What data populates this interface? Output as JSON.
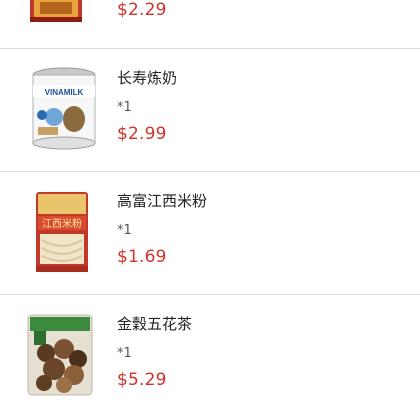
{
  "items": [
    {
      "name": "",
      "qty": "",
      "price": "$2.29",
      "icon": "sauce-packet-icon"
    },
    {
      "name": "长寿炼奶",
      "qty": "*1",
      "price": "$2.99",
      "icon": "condensed-milk-can-icon",
      "brand": "VINAMILK"
    },
    {
      "name": "高富江西米粉",
      "qty": "*1",
      "price": "$1.69",
      "icon": "rice-vermicelli-bag-icon",
      "package_text": "江西米粉"
    },
    {
      "name": "金穀五花茶",
      "qty": "*1",
      "price": "$5.29",
      "icon": "herbal-tea-bag-icon"
    }
  ],
  "colors": {
    "price": "#d0322b",
    "divider": "#dcdcdc"
  }
}
